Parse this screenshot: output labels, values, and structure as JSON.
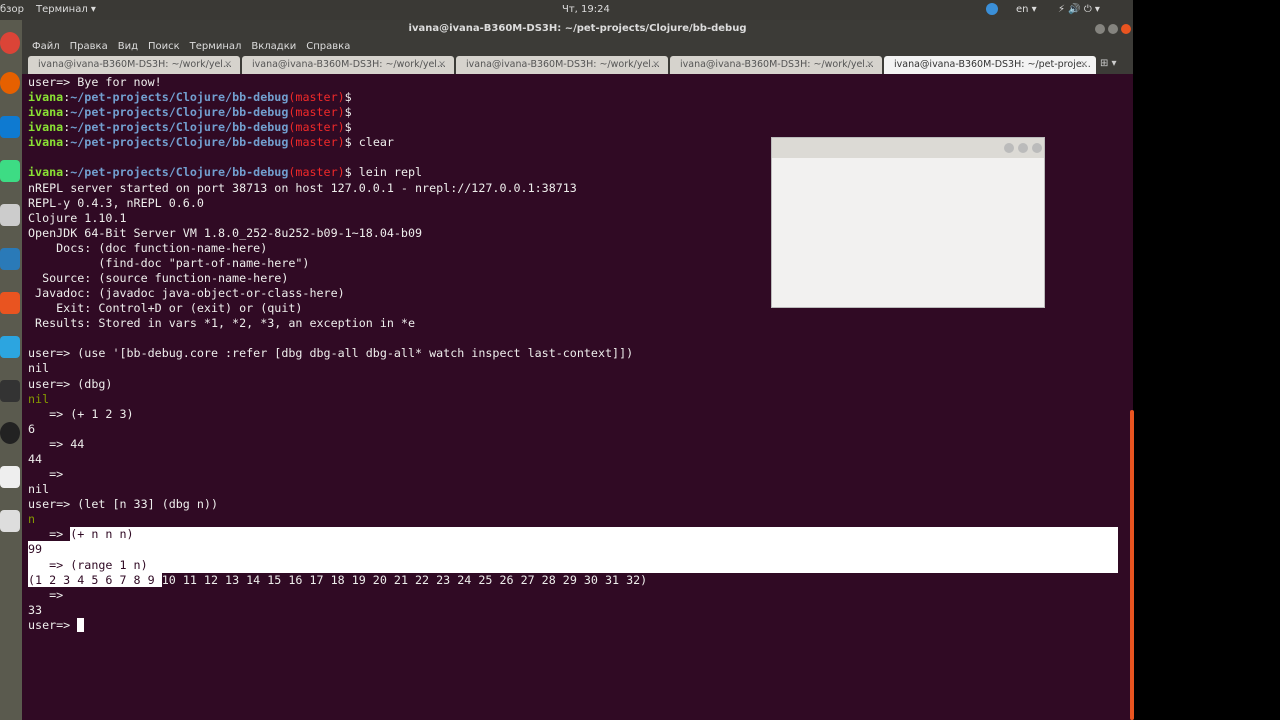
{
  "topbar": {
    "overview": "бзор",
    "app_menu": "Терминал ▾",
    "clock": "Чт, 19:24",
    "lang": "en ▾",
    "system": "⚡ 🔊 ⏻ ▾"
  },
  "window": {
    "title": "ivana@ivana-B360M-DS3H: ~/pet-projects/Clojure/bb-debug"
  },
  "menu": [
    "Файл",
    "Правка",
    "Вид",
    "Поиск",
    "Терминал",
    "Вкладки",
    "Справка"
  ],
  "tabs": [
    {
      "label": "ivana@ivana-B360M-DS3H: ~/work/yel...",
      "active": false
    },
    {
      "label": "ivana@ivana-B360M-DS3H: ~/work/yel...",
      "active": false
    },
    {
      "label": "ivana@ivana-B360M-DS3H: ~/work/yel...",
      "active": false
    },
    {
      "label": "ivana@ivana-B360M-DS3H: ~/work/yel...",
      "active": false
    },
    {
      "label": "ivana@ivana-B360M-DS3H: ~/pet-proje...",
      "active": true
    }
  ],
  "tab_close": "×",
  "new_tab": "⊞ ▾",
  "colors": {
    "bg": "#300a24",
    "user": "#8ae234",
    "path": "#729fcf",
    "branch": "#ef2929",
    "accent": "#e95420"
  },
  "terminal": [
    [
      [
        "user=> Bye for now!",
        ""
      ]
    ],
    [
      [
        "ivana",
        "g"
      ],
      [
        ":",
        ""
      ],
      [
        "~/pet-projects/Clojure/bb-debug",
        "b"
      ],
      [
        "(master)",
        "r"
      ],
      [
        "$",
        ""
      ]
    ],
    [
      [
        "ivana",
        "g"
      ],
      [
        ":",
        ""
      ],
      [
        "~/pet-projects/Clojure/bb-debug",
        "b"
      ],
      [
        "(master)",
        "r"
      ],
      [
        "$",
        ""
      ]
    ],
    [
      [
        "ivana",
        "g"
      ],
      [
        ":",
        ""
      ],
      [
        "~/pet-projects/Clojure/bb-debug",
        "b"
      ],
      [
        "(master)",
        "r"
      ],
      [
        "$",
        ""
      ]
    ],
    [
      [
        "ivana",
        "g"
      ],
      [
        ":",
        ""
      ],
      [
        "~/pet-projects/Clojure/bb-debug",
        "b"
      ],
      [
        "(master)",
        "r"
      ],
      [
        "$ clear",
        ""
      ]
    ],
    [],
    [
      [
        "ivana",
        "g"
      ],
      [
        ":",
        ""
      ],
      [
        "~/pet-projects/Clojure/bb-debug",
        "b"
      ],
      [
        "(master)",
        "r"
      ],
      [
        "$ lein repl",
        ""
      ]
    ],
    [
      [
        "nREPL server started on port 38713 on host 127.0.0.1 - nrepl://127.0.0.1:38713",
        ""
      ]
    ],
    [
      [
        "REPL-y 0.4.3, nREPL 0.6.0",
        ""
      ]
    ],
    [
      [
        "Clojure 1.10.1",
        ""
      ]
    ],
    [
      [
        "OpenJDK 64-Bit Server VM 1.8.0_252-8u252-b09-1~18.04-b09",
        ""
      ]
    ],
    [
      [
        "    Docs: (doc function-name-here)",
        ""
      ]
    ],
    [
      [
        "          (find-doc \"part-of-name-here\")",
        ""
      ]
    ],
    [
      [
        "  Source: (source function-name-here)",
        ""
      ]
    ],
    [
      [
        " Javadoc: (javadoc java-object-or-class-here)",
        ""
      ]
    ],
    [
      [
        "    Exit: Control+D or (exit) or (quit)",
        ""
      ]
    ],
    [
      [
        " Results: Stored in vars *1, *2, *3, an exception in *e",
        ""
      ]
    ],
    [],
    [
      [
        "user=> (use '[bb-debug.core :refer [dbg dbg-all dbg-all* watch inspect last-context]])",
        ""
      ]
    ],
    [
      [
        "nil",
        ""
      ]
    ],
    [
      [
        "user=> (dbg)",
        ""
      ]
    ],
    [
      [
        "nil",
        "o"
      ]
    ],
    [
      [
        "   => (+ 1 2 3)",
        ""
      ]
    ],
    [
      [
        "6",
        ""
      ]
    ],
    [
      [
        "   => 44",
        ""
      ]
    ],
    [
      [
        "44",
        ""
      ]
    ],
    [
      [
        "   =>",
        ""
      ]
    ],
    [
      [
        "nil",
        ""
      ]
    ],
    [
      [
        "user=> (let [n 33] (dbg n))",
        ""
      ]
    ],
    [
      [
        "n",
        "o"
      ]
    ],
    [
      [
        "   => ",
        "n"
      ],
      [
        "(+ n n n)",
        "s"
      ]
    ],
    [
      [
        "99",
        "s"
      ]
    ],
    [
      [
        "   => (range 1 n)",
        "s"
      ]
    ],
    [
      [
        "(1 2 3 4 5 6 7 8 9 ",
        "s"
      ],
      [
        "10 11 12 13 14 15 16 17 18 19 20 21 22 23 24 25 26 27 28 29 30 31 32)",
        ""
      ]
    ],
    [
      [
        "   =>",
        ""
      ]
    ],
    [
      [
        "33",
        ""
      ]
    ],
    [
      [
        "user=> ",
        ""
      ]
    ]
  ]
}
